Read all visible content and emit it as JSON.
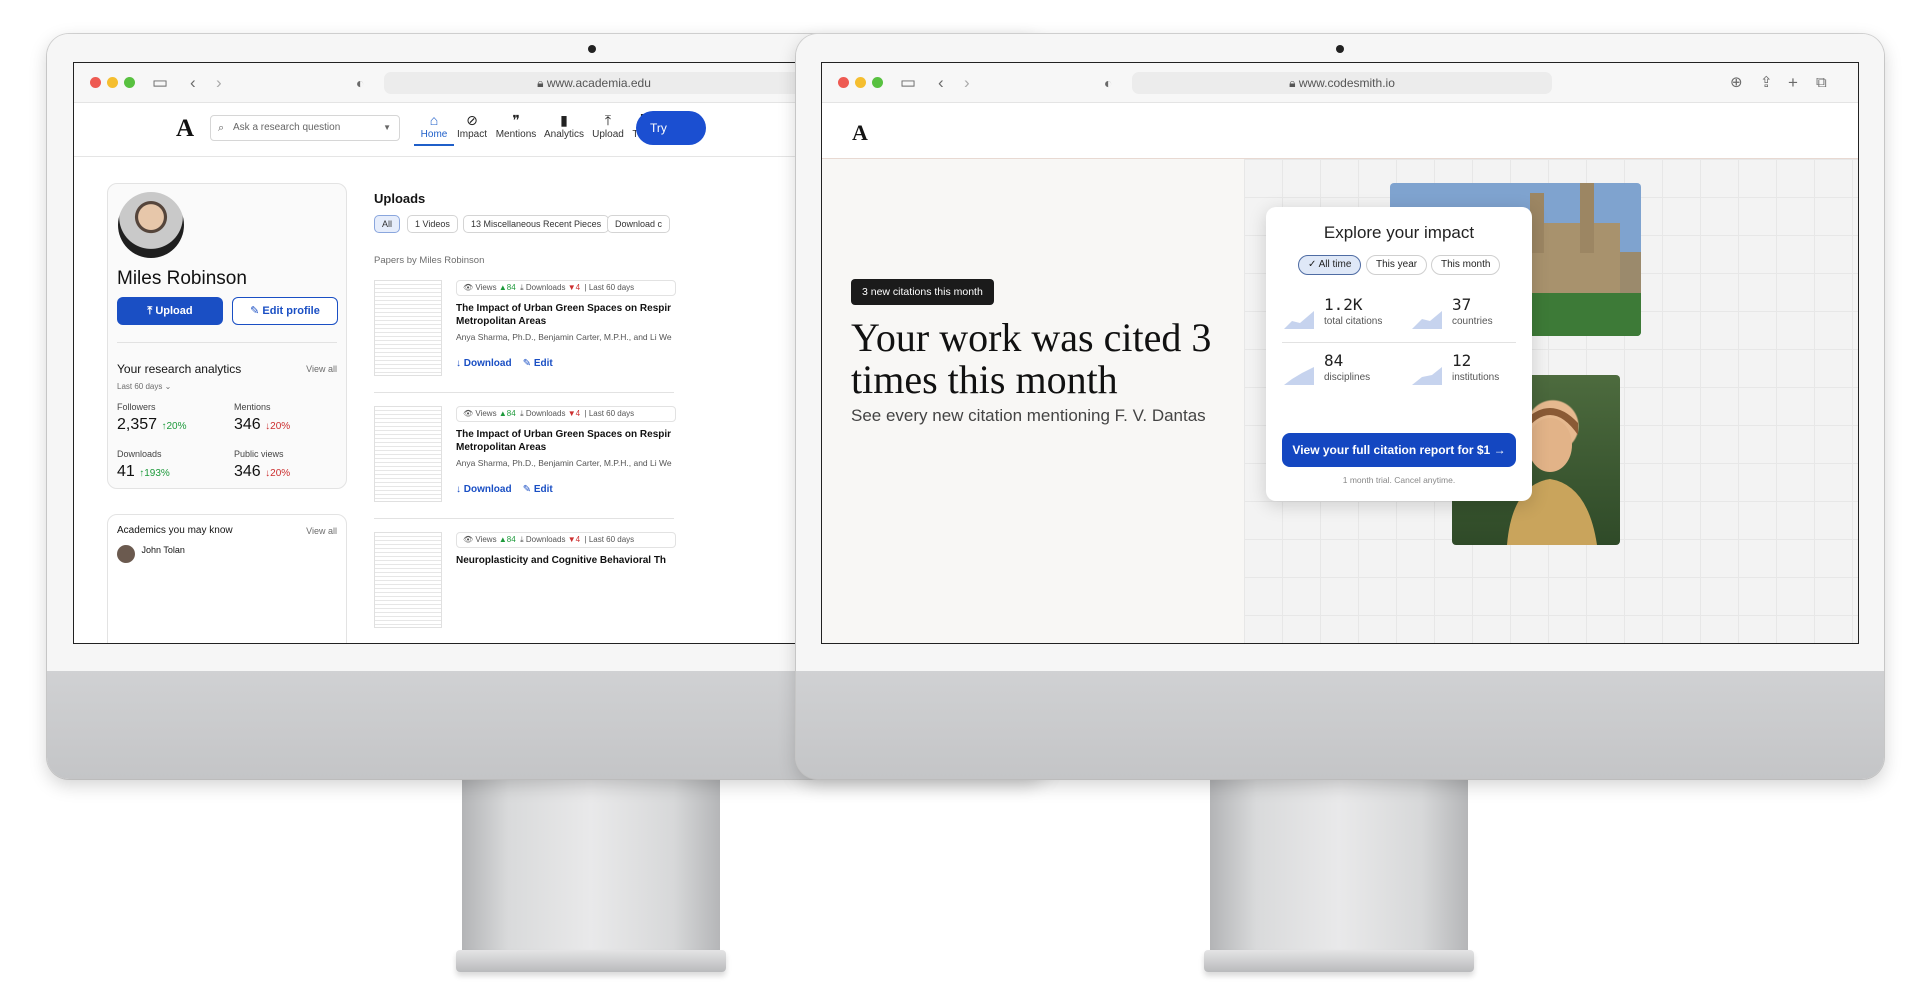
{
  "left_window": {
    "url": "www.academia.edu",
    "nav": {
      "logo": "A",
      "search_placeholder": "Ask a research question",
      "items": [
        {
          "label": "Home",
          "icon": "home-icon"
        },
        {
          "label": "Impact",
          "icon": "impact-icon"
        },
        {
          "label": "Mentions",
          "icon": "quote-icon"
        },
        {
          "label": "Analytics",
          "icon": "bar-chart-icon"
        },
        {
          "label": "Upload",
          "icon": "upload-icon"
        },
        {
          "label": "Tools",
          "icon": "grid-icon"
        }
      ],
      "try_label": "Try"
    },
    "profile": {
      "name": "Miles Robinson",
      "upload_label": "Upload",
      "edit_label": "Edit profile",
      "analytics_title": "Your research analytics",
      "view_all": "View all",
      "range": "Last 60 days",
      "stats": [
        {
          "label": "Followers",
          "value": "2,357",
          "delta": "20%",
          "dir": "up"
        },
        {
          "label": "Mentions",
          "value": "346",
          "delta": "20%",
          "dir": "down"
        },
        {
          "label": "Downloads",
          "value": "41",
          "delta": "193%",
          "dir": "up"
        },
        {
          "label": "Public views",
          "value": "346",
          "delta": "20%",
          "dir": "down"
        }
      ]
    },
    "academics": {
      "title": "Academics you may know",
      "view_all": "View all",
      "first_name": "John Tolan"
    },
    "uploads": {
      "title": "Uploads",
      "filters": [
        "All",
        "1 Videos",
        "13 Miscellaneous Recent Pieces",
        "Download c"
      ],
      "section": "Papers by Miles Robinson",
      "meta": {
        "views": "Views",
        "views_delta": "84",
        "downloads": "Downloads",
        "downloads_delta": "4",
        "range": "Last 60 days"
      },
      "papers": [
        {
          "title": "The Impact of Urban Green Spaces on Respir Metropolitan Areas",
          "authors": "Anya Sharma, Ph.D., Benjamin Carter, M.P.H., and Li We",
          "download": "Download",
          "edit": "Edit"
        },
        {
          "title": "The Impact of Urban Green Spaces on Respir Metropolitan Areas",
          "authors": "Anya Sharma, Ph.D., Benjamin Carter, M.P.H., and Li We",
          "download": "Download",
          "edit": "Edit"
        },
        {
          "title": "Neuroplasticity and Cognitive Behavioral Th",
          "authors": "",
          "download": "",
          "edit": ""
        }
      ]
    }
  },
  "right_window": {
    "url": "www.codesmith.io",
    "logo": "A",
    "badge": "3 new citations this month",
    "headline": "Your work was cited 3 times this month",
    "subline": "See every new citation mentioning F. V. Dantas",
    "card": {
      "title": "Explore your impact",
      "pills": [
        "✓ All time",
        "This year",
        "This month"
      ],
      "metrics": [
        {
          "value": "1.2K",
          "label": "total citations"
        },
        {
          "value": "37",
          "label": "countries"
        },
        {
          "value": "84",
          "label": "disciplines"
        },
        {
          "value": "12",
          "label": "institutions"
        }
      ],
      "cta": "View your full citation report for $1 →",
      "fine_print": "1 month trial. Cancel anytime."
    }
  },
  "colors": {
    "accent": "#1a4fc4",
    "up": "#1d9a3b",
    "down": "#cc2f2f"
  }
}
